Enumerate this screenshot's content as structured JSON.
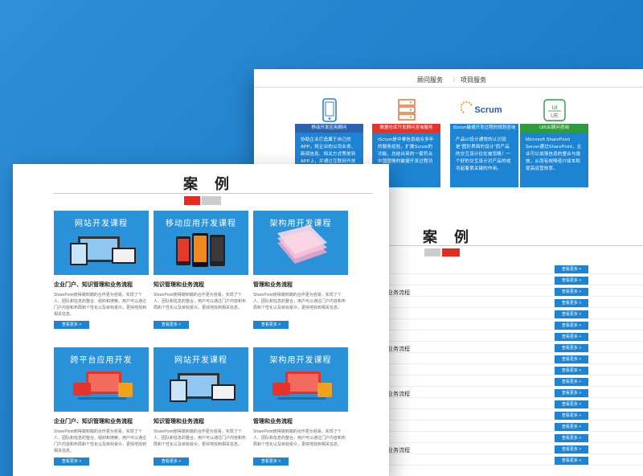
{
  "back_page": {
    "tabs": [
      "顾问服务",
      "项目服务"
    ],
    "services": [
      {
        "caption": "移动开发应用顾问",
        "caption_color": "#2a62b0",
        "icon": "mobile-phone-icon",
        "text": "协助企业打造属于自己的APP，将企业的公司业务、新闻信息、相关方式等放到APP上，并通过互联网开放给客户"
      },
      {
        "caption": "数据仓库开发顾问咨询服务",
        "caption_color": "#e5332a",
        "icon": "database-icon",
        "text": "iScrum是中睿信息结合多年的服务经验，扩展Scrum的功能，总结出来的一套符合中国国情的敏捷开发过程功能。"
      },
      {
        "caption": "iScrum敏捷开发过程的规划咨询",
        "caption_color": "#1d84d3",
        "icon": "scrum-logo-icon",
        "icon_text": "Scrum",
        "text": "产品UI设计通常的认识就是“图形界面的设计”而产品的交互设计往往被忽略！一个好的交互设计对产品的成功起着很关键的作用。"
      },
      {
        "caption": "UI/UE顾问咨询",
        "caption_color": "#2e9b3c",
        "icon": "ui-ue-icon",
        "icon_text": "UI/UE",
        "text": "Microsoft SharePoint Server通过SharePoint，企业可以加强信息的整合与投放，从而有效降低IT成本和提高运营效率。"
      }
    ],
    "title": "案 例",
    "row_button": "查看更多 >",
    "row_labels": [
      "业务流程",
      "业务流程",
      "业务流程",
      "业务流程"
    ]
  },
  "front_page": {
    "title": "案 例",
    "cards": [
      {
        "image_title": "网站开发课程",
        "heading": "企业门户、知识管理和业务流程",
        "desc": "SharePoint使得端到端的合作更为容易，实现了个人、团队和信息的整合、组织和搜索。用户可以通过门户内容和布局和个性化以及目标受众，更快地找到相关信息。",
        "button": "查看更多 >",
        "art": "devices"
      },
      {
        "image_title": "移动应用开发课程",
        "heading": "知识管理和业务流程",
        "desc": "SharePoint使得端到端的合作更为容易，实现了个人、团队和信息的整合。用户可以通过门户内容和布局和个性化以及目标受众，更快地找到相关信息。",
        "button": "查看更多 >",
        "art": "phones"
      },
      {
        "image_title": "架构用开发课程",
        "heading": "管理和业务流程",
        "desc": "SharePoint使得端到端的合作更为容易，实现了个人、团队和信息的整合，用户可以通过门户内容和布局和个性化以及目标受众，更快地找到相关信息。",
        "button": "查看更多 >",
        "art": "layers"
      },
      {
        "image_title": "跨平台应用开发",
        "heading": "企业门户、知识管理和业务流程",
        "desc": "SharePoint使得端到端的合作更为容易，实现了个人、团队和信息的整合、组织和搜索。用户可以通过门户内容和布局和个性化以及目标受众，更快地找到相关信息。",
        "button": "查看更多 >",
        "art": "cross"
      },
      {
        "image_title": "网站开发课程",
        "heading": "知识管理和业务流程",
        "desc": "SharePoint使得端到端的合作更为容易，实现了个人、团队和信息的整合。用户可以通过门户内容和布局和个性化以及目标受众，更快地找到相关信息。",
        "button": "查看更多 >",
        "art": "devices"
      },
      {
        "image_title": "架构用开发课程",
        "heading": "管理和业务流程",
        "desc": "SharePoint使得端到端的合作更为容易，实现了个人、团队和信息的整合，用户可以通过门户内容和布局和个性化以及目标受众，更快地找到相关信息。",
        "button": "查看更多 >",
        "art": "cross"
      }
    ]
  }
}
